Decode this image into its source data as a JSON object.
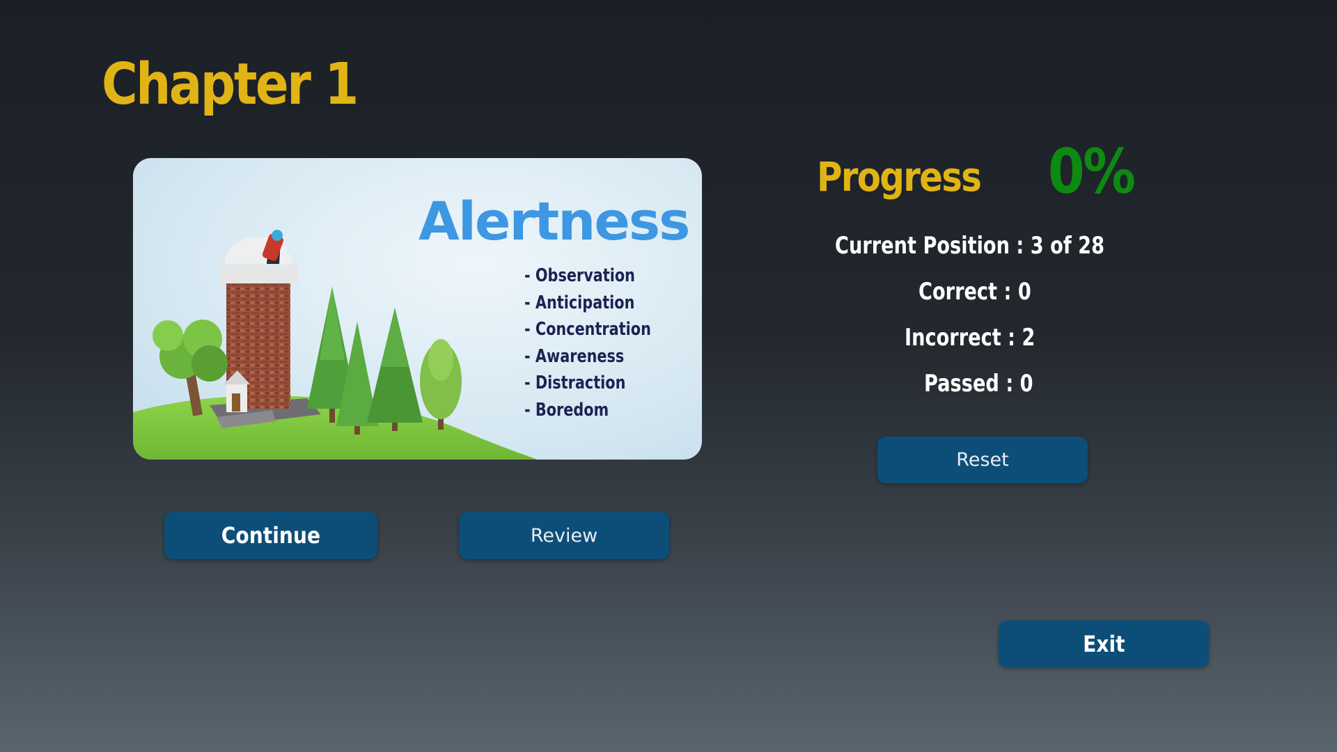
{
  "chapter": {
    "title": "Chapter 1"
  },
  "card": {
    "title": "Alertness",
    "items": [
      "- Observation",
      "- Anticipation",
      "- Concentration",
      "- Awareness",
      "- Distraction",
      "- Boredom"
    ]
  },
  "progress": {
    "label": "Progress",
    "value": "0%",
    "current_position": "Current Position : 3 of 28",
    "correct": "Correct : 0",
    "incorrect": "Incorrect : 2",
    "passed": "Passed : 0"
  },
  "buttons": {
    "continue": "Continue",
    "review": "Review",
    "reset": "Reset",
    "exit": "Exit"
  },
  "colors": {
    "accent_yellow": "#e1b416",
    "progress_green": "#0d8a12",
    "button_blue": "#0c4e78",
    "card_title_blue": "#3d97e2"
  }
}
